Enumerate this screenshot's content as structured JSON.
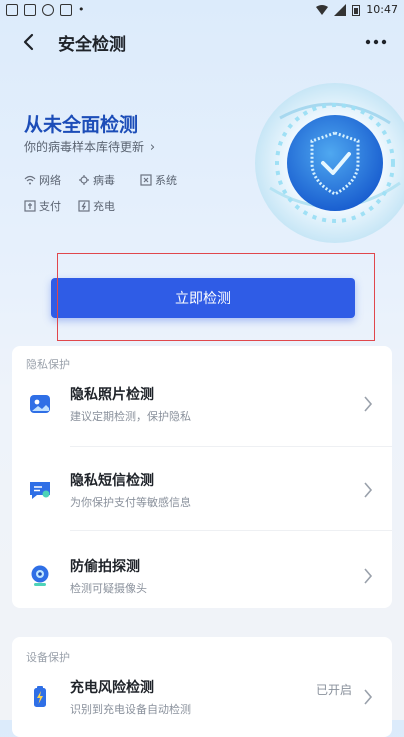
{
  "status_bar": {
    "time": "10:47"
  },
  "header": {
    "title": "安全检测"
  },
  "hero": {
    "title": "从未全面检测",
    "subtitle": "你的病毒样本库待更新",
    "checks": [
      {
        "label": "网络",
        "icon": "wifi-icon"
      },
      {
        "label": "病毒",
        "icon": "virus-icon"
      },
      {
        "label": "系统",
        "icon": "system-icon"
      },
      {
        "label": "支付",
        "icon": "payment-icon"
      },
      {
        "label": "充电",
        "icon": "battery-icon"
      }
    ]
  },
  "scan_button": {
    "label": "立即检测"
  },
  "privacy": {
    "section": "隐私保护",
    "items": [
      {
        "name": "隐私照片检测",
        "desc": "建议定期检测，保护隐私",
        "icon": "photo-icon"
      },
      {
        "name": "隐私短信检测",
        "desc": "为你保护支付等敏感信息",
        "icon": "message-icon"
      },
      {
        "name": "防偷拍探测",
        "desc": "检测可疑摄像头",
        "icon": "camera-icon"
      }
    ]
  },
  "device": {
    "section": "设备保护",
    "items": [
      {
        "name": "充电风险检测",
        "desc": "识别到充电设备自动检测",
        "status": "已开启",
        "icon": "charging-icon"
      }
    ]
  },
  "colors": {
    "accent": "#2f5ce6",
    "hero_title": "#1c4db8",
    "highlight_box": "#e0474c"
  }
}
